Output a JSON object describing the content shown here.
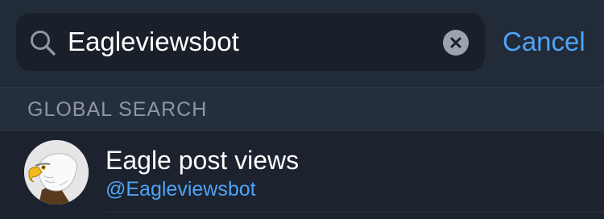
{
  "search": {
    "query": "Eagleviewsbot",
    "cancel_label": "Cancel"
  },
  "section": {
    "title": "GLOBAL SEARCH"
  },
  "results": [
    {
      "name": "Eagle post views",
      "username": "@Eagleviewsbot",
      "avatar_icon": "eagle-icon"
    }
  ],
  "colors": {
    "background": "#1c232e",
    "header_background": "#222b38",
    "section_background": "#252e3b",
    "field_background": "#1a2029",
    "accent": "#4fa3f7",
    "text_primary": "#ffffff",
    "text_secondary": "#8e97a3"
  }
}
